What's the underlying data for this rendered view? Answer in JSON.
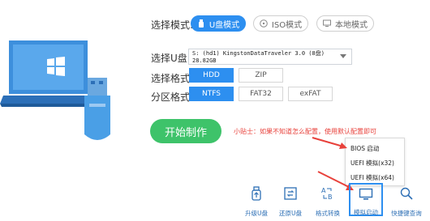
{
  "mode": {
    "label": "选择模式:",
    "tabs": [
      {
        "label": "U盘模式",
        "icon": "usb-icon",
        "active": true
      },
      {
        "label": "ISO模式",
        "icon": "disc-icon",
        "active": false
      },
      {
        "label": "本地模式",
        "icon": "monitor-icon",
        "active": false
      }
    ]
  },
  "usb_select": {
    "label": "选择U盘:",
    "value": "S: (hd1) KingstonDataTraveler 3.0 (8盘) 28.82GB"
  },
  "format": {
    "label": "选择格式:",
    "options": [
      "HDD",
      "ZIP"
    ],
    "selected": "HDD"
  },
  "partition": {
    "label": "分区格式:",
    "options": [
      "NTFS",
      "FAT32",
      "exFAT"
    ],
    "selected": "NTFS"
  },
  "start_button": "开始制作",
  "tip": "小贴士：如果不知道怎么配置，使用默认配置即可",
  "simulate_menu": {
    "items": [
      "BIOS 启动",
      "UEFI 模拟(x32)",
      "UEFI 模拟(x64)"
    ]
  },
  "toolbar": {
    "items": [
      {
        "label": "升级U盘",
        "icon": "usb-upgrade-icon"
      },
      {
        "label": "还原U盘",
        "icon": "restore-icon"
      },
      {
        "label": "格式转换",
        "icon": "format-convert-icon"
      },
      {
        "label": "模拟启动",
        "icon": "monitor-icon"
      },
      {
        "label": "快捷键查询",
        "icon": "search-icon"
      }
    ]
  },
  "colors": {
    "accent": "#2d8ff0",
    "start": "#3ec36a",
    "tip": "#e8413b",
    "arrow": "#e8413b"
  }
}
